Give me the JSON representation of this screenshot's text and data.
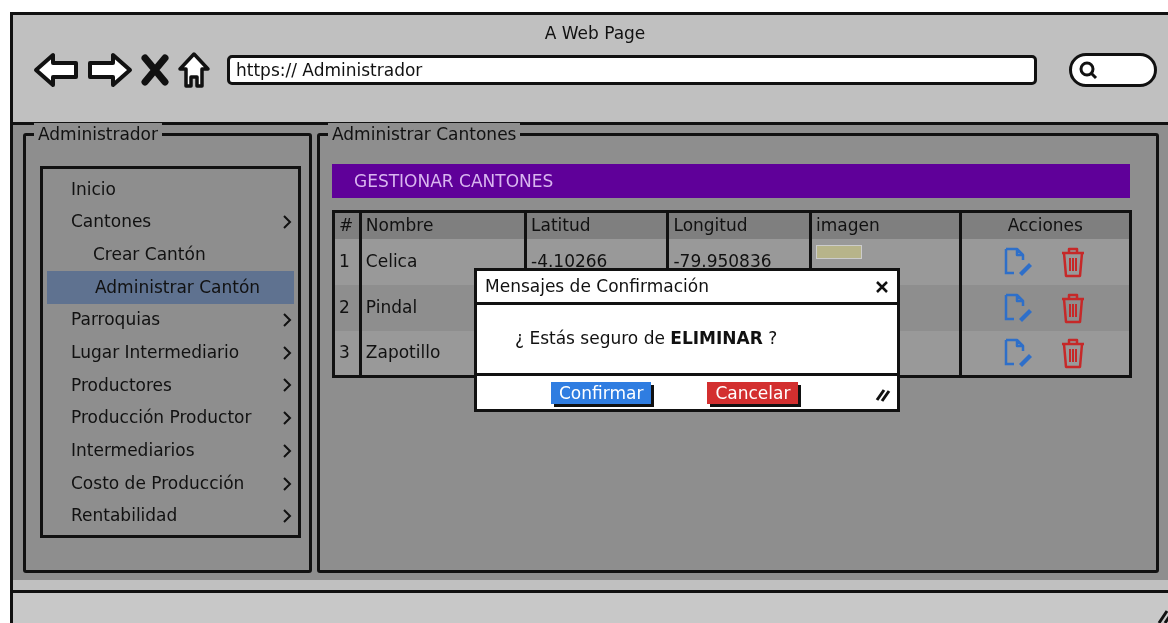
{
  "browser": {
    "title": "A Web Page",
    "url": "https:// Administrador"
  },
  "sidebar": {
    "title": "Administrador",
    "items": [
      {
        "label": "Inicio",
        "selected": false,
        "has_submenu": false
      },
      {
        "label": "Cantones",
        "selected": false,
        "has_submenu": true,
        "children": [
          {
            "label": "Crear Cantón",
            "selected": false
          },
          {
            "label": "Administrar Cantón",
            "selected": true
          }
        ]
      },
      {
        "label": "Parroquias",
        "selected": false,
        "has_submenu": true
      },
      {
        "label": "Lugar Intermediario",
        "selected": false,
        "has_submenu": true
      },
      {
        "label": "Productores",
        "selected": false,
        "has_submenu": true
      },
      {
        "label": "Producción Productor",
        "selected": false,
        "has_submenu": true
      },
      {
        "label": "Intermediarios",
        "selected": false,
        "has_submenu": true
      },
      {
        "label": "Costo de Producción",
        "selected": false,
        "has_submenu": true
      },
      {
        "label": "Rentabilidad",
        "selected": false,
        "has_submenu": true
      }
    ]
  },
  "main": {
    "title": "Administrar Cantones",
    "header": "GESTIONAR CANTONES",
    "table": {
      "columns": [
        "#",
        "Nombre",
        "Latitud",
        "Longitud",
        "imagen",
        "Acciones"
      ],
      "rows": [
        {
          "cells": [
            "1",
            "Celica",
            "-4.10266",
            "-79.950836"
          ],
          "has_image": true
        },
        {
          "cells": [
            "2",
            "Pindal",
            "",
            ""
          ]
        },
        {
          "cells": [
            "3",
            "Zapotillo",
            "",
            ""
          ]
        }
      ]
    }
  },
  "dialog": {
    "title": "Mensajes de Confirmación",
    "message": "¿ Estás seguro de **ELIMINAR** ?",
    "buttons": [
      {
        "label": "Confirmar",
        "kind": "primary"
      },
      {
        "label": "Cancelar",
        "kind": "danger"
      }
    ]
  }
}
